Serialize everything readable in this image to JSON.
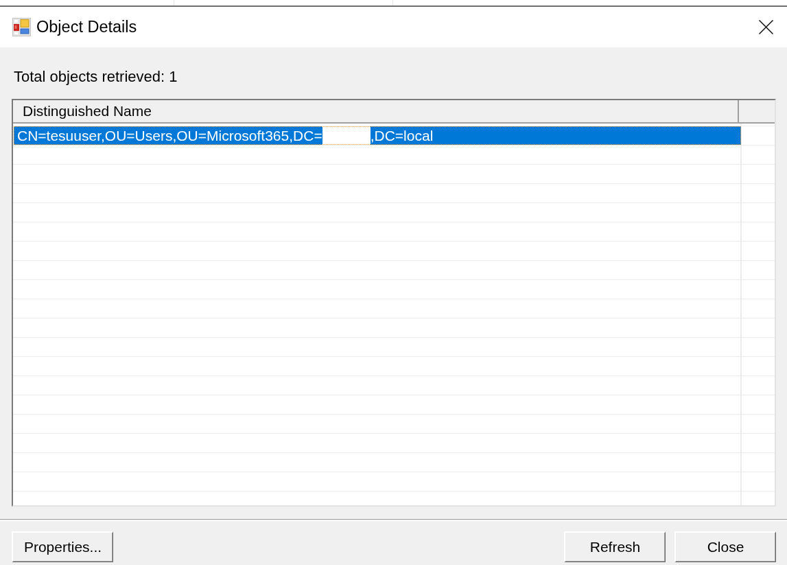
{
  "window": {
    "title": "Object Details"
  },
  "summary": "Total objects retrieved: 1",
  "list": {
    "columns": [
      "Distinguished Name"
    ],
    "rows": [
      {
        "selected": true,
        "cells": [
          {
            "parts": [
              "CN=tesuuser,OU=Users,OU=Microsoft365,DC=",
              ",DC=local"
            ]
          }
        ]
      }
    ]
  },
  "left_buttons": [
    "Properties..."
  ],
  "right_buttons": [
    "Refresh",
    "Close"
  ]
}
